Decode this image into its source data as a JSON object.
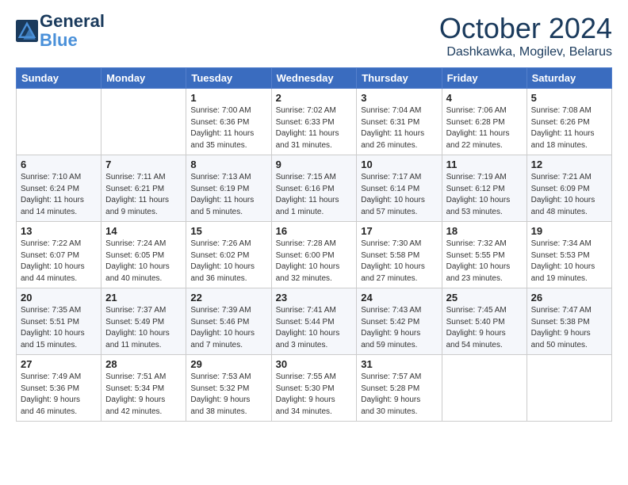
{
  "header": {
    "logo_line1": "General",
    "logo_line2": "Blue",
    "month_title": "October 2024",
    "subtitle": "Dashkawka, Mogilev, Belarus"
  },
  "days_of_week": [
    "Sunday",
    "Monday",
    "Tuesday",
    "Wednesday",
    "Thursday",
    "Friday",
    "Saturday"
  ],
  "weeks": [
    [
      {
        "day": "",
        "info": ""
      },
      {
        "day": "",
        "info": ""
      },
      {
        "day": "1",
        "info": "Sunrise: 7:00 AM\nSunset: 6:36 PM\nDaylight: 11 hours\nand 35 minutes."
      },
      {
        "day": "2",
        "info": "Sunrise: 7:02 AM\nSunset: 6:33 PM\nDaylight: 11 hours\nand 31 minutes."
      },
      {
        "day": "3",
        "info": "Sunrise: 7:04 AM\nSunset: 6:31 PM\nDaylight: 11 hours\nand 26 minutes."
      },
      {
        "day": "4",
        "info": "Sunrise: 7:06 AM\nSunset: 6:28 PM\nDaylight: 11 hours\nand 22 minutes."
      },
      {
        "day": "5",
        "info": "Sunrise: 7:08 AM\nSunset: 6:26 PM\nDaylight: 11 hours\nand 18 minutes."
      }
    ],
    [
      {
        "day": "6",
        "info": "Sunrise: 7:10 AM\nSunset: 6:24 PM\nDaylight: 11 hours\nand 14 minutes."
      },
      {
        "day": "7",
        "info": "Sunrise: 7:11 AM\nSunset: 6:21 PM\nDaylight: 11 hours\nand 9 minutes."
      },
      {
        "day": "8",
        "info": "Sunrise: 7:13 AM\nSunset: 6:19 PM\nDaylight: 11 hours\nand 5 minutes."
      },
      {
        "day": "9",
        "info": "Sunrise: 7:15 AM\nSunset: 6:16 PM\nDaylight: 11 hours\nand 1 minute."
      },
      {
        "day": "10",
        "info": "Sunrise: 7:17 AM\nSunset: 6:14 PM\nDaylight: 10 hours\nand 57 minutes."
      },
      {
        "day": "11",
        "info": "Sunrise: 7:19 AM\nSunset: 6:12 PM\nDaylight: 10 hours\nand 53 minutes."
      },
      {
        "day": "12",
        "info": "Sunrise: 7:21 AM\nSunset: 6:09 PM\nDaylight: 10 hours\nand 48 minutes."
      }
    ],
    [
      {
        "day": "13",
        "info": "Sunrise: 7:22 AM\nSunset: 6:07 PM\nDaylight: 10 hours\nand 44 minutes."
      },
      {
        "day": "14",
        "info": "Sunrise: 7:24 AM\nSunset: 6:05 PM\nDaylight: 10 hours\nand 40 minutes."
      },
      {
        "day": "15",
        "info": "Sunrise: 7:26 AM\nSunset: 6:02 PM\nDaylight: 10 hours\nand 36 minutes."
      },
      {
        "day": "16",
        "info": "Sunrise: 7:28 AM\nSunset: 6:00 PM\nDaylight: 10 hours\nand 32 minutes."
      },
      {
        "day": "17",
        "info": "Sunrise: 7:30 AM\nSunset: 5:58 PM\nDaylight: 10 hours\nand 27 minutes."
      },
      {
        "day": "18",
        "info": "Sunrise: 7:32 AM\nSunset: 5:55 PM\nDaylight: 10 hours\nand 23 minutes."
      },
      {
        "day": "19",
        "info": "Sunrise: 7:34 AM\nSunset: 5:53 PM\nDaylight: 10 hours\nand 19 minutes."
      }
    ],
    [
      {
        "day": "20",
        "info": "Sunrise: 7:35 AM\nSunset: 5:51 PM\nDaylight: 10 hours\nand 15 minutes."
      },
      {
        "day": "21",
        "info": "Sunrise: 7:37 AM\nSunset: 5:49 PM\nDaylight: 10 hours\nand 11 minutes."
      },
      {
        "day": "22",
        "info": "Sunrise: 7:39 AM\nSunset: 5:46 PM\nDaylight: 10 hours\nand 7 minutes."
      },
      {
        "day": "23",
        "info": "Sunrise: 7:41 AM\nSunset: 5:44 PM\nDaylight: 10 hours\nand 3 minutes."
      },
      {
        "day": "24",
        "info": "Sunrise: 7:43 AM\nSunset: 5:42 PM\nDaylight: 9 hours\nand 59 minutes."
      },
      {
        "day": "25",
        "info": "Sunrise: 7:45 AM\nSunset: 5:40 PM\nDaylight: 9 hours\nand 54 minutes."
      },
      {
        "day": "26",
        "info": "Sunrise: 7:47 AM\nSunset: 5:38 PM\nDaylight: 9 hours\nand 50 minutes."
      }
    ],
    [
      {
        "day": "27",
        "info": "Sunrise: 7:49 AM\nSunset: 5:36 PM\nDaylight: 9 hours\nand 46 minutes."
      },
      {
        "day": "28",
        "info": "Sunrise: 7:51 AM\nSunset: 5:34 PM\nDaylight: 9 hours\nand 42 minutes."
      },
      {
        "day": "29",
        "info": "Sunrise: 7:53 AM\nSunset: 5:32 PM\nDaylight: 9 hours\nand 38 minutes."
      },
      {
        "day": "30",
        "info": "Sunrise: 7:55 AM\nSunset: 5:30 PM\nDaylight: 9 hours\nand 34 minutes."
      },
      {
        "day": "31",
        "info": "Sunrise: 7:57 AM\nSunset: 5:28 PM\nDaylight: 9 hours\nand 30 minutes."
      },
      {
        "day": "",
        "info": ""
      },
      {
        "day": "",
        "info": ""
      }
    ]
  ]
}
